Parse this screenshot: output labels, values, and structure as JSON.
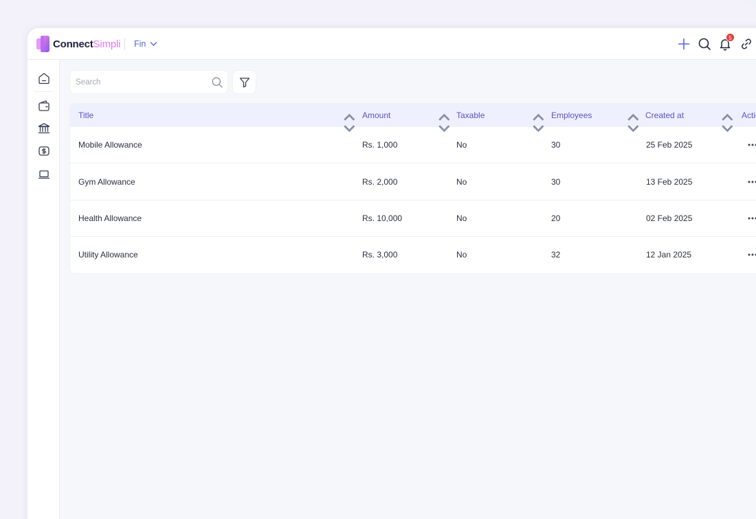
{
  "brand": {
    "part1": "Connect",
    "part2": "Simpli"
  },
  "workspace": {
    "label": "Fin"
  },
  "notifications": {
    "count": "5"
  },
  "search": {
    "placeholder": "Search"
  },
  "table": {
    "columns": [
      "Title",
      "Amount",
      "Taxable",
      "Employees",
      "Created at",
      "Actio"
    ],
    "rows": [
      {
        "title": "Mobile Allowance",
        "amount": "Rs. 1,000",
        "taxable": "No",
        "employees": "30",
        "created": "25 Feb 2025"
      },
      {
        "title": "Gym Allowance",
        "amount": "Rs. 2,000",
        "taxable": "No",
        "employees": "30",
        "created": "13 Feb 2025"
      },
      {
        "title": "Health Allowance",
        "amount": "Rs. 10,000",
        "taxable": "No",
        "employees": "20",
        "created": "02 Feb 2025"
      },
      {
        "title": "Utility Allowance",
        "amount": "Rs. 3,000",
        "taxable": "No",
        "employees": "32",
        "created": "12 Jan 2025"
      }
    ]
  },
  "sidebar": {
    "items": [
      {
        "name": "home-icon"
      },
      {
        "name": "wallet-icon"
      },
      {
        "name": "bank-icon"
      },
      {
        "name": "payroll-icon"
      },
      {
        "name": "laptop-icon"
      }
    ]
  },
  "colors": {
    "accent": "#5a52c8",
    "brand_dark": "#1b1e3c",
    "brand_pink": "#dd7cf0",
    "header_bg": "#eef1fd",
    "badge": "#e53b3b"
  }
}
